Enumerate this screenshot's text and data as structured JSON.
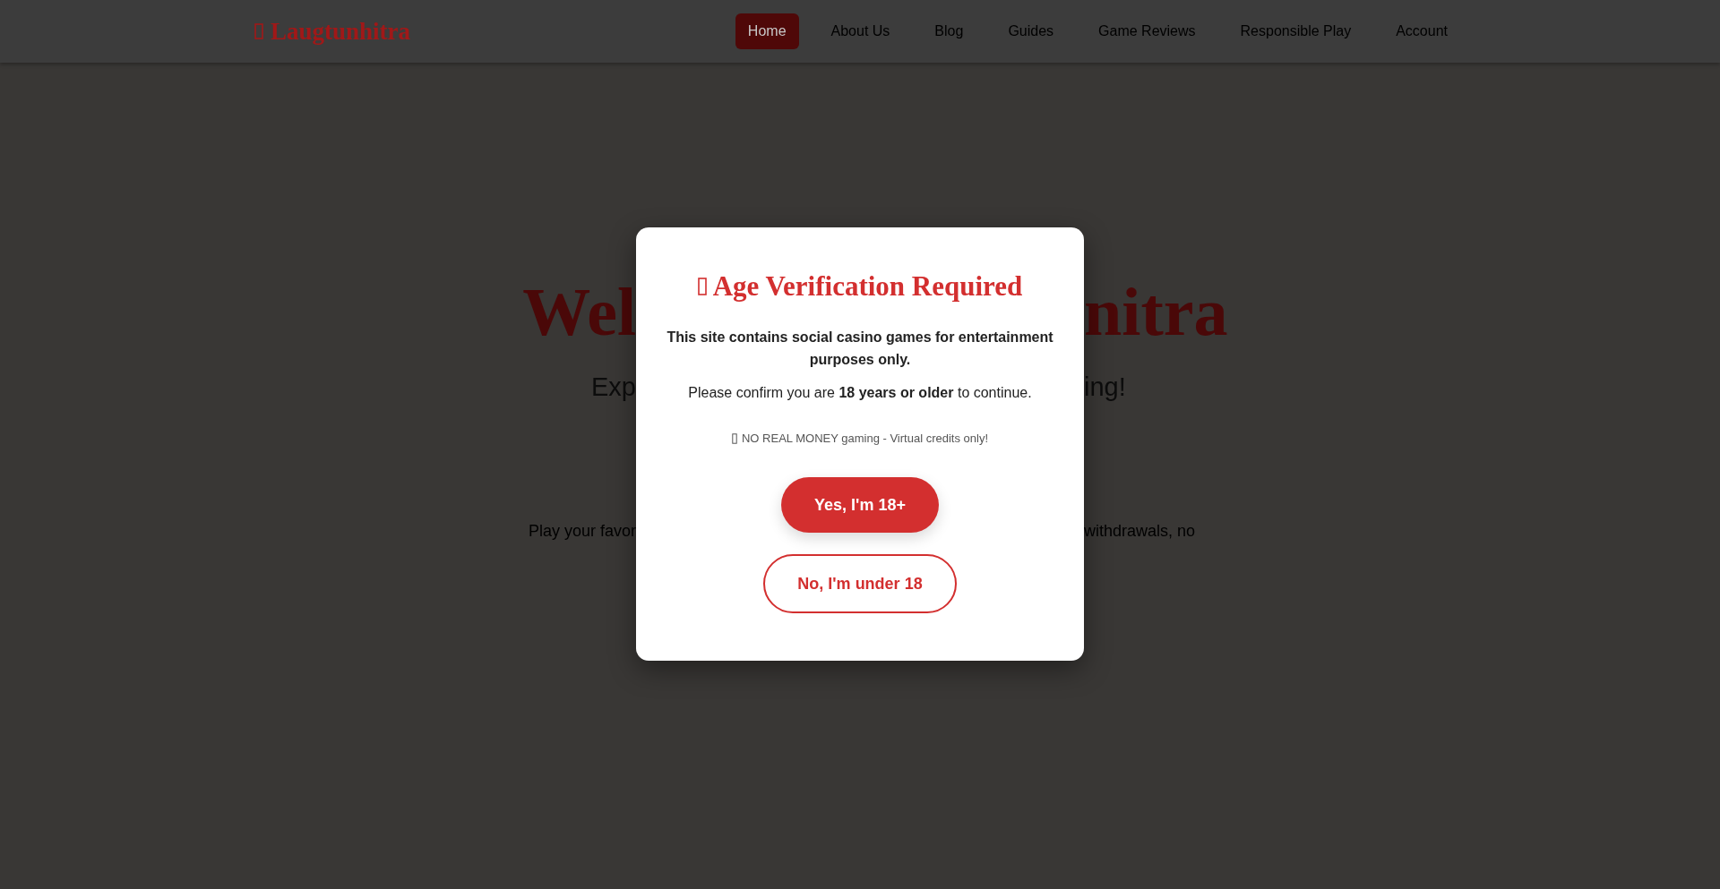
{
  "header": {
    "logo": "Laugtunhitra",
    "nav": [
      {
        "label": "Home",
        "selected": true
      },
      {
        "label": "About Us",
        "selected": false
      },
      {
        "label": "Blog",
        "selected": false
      },
      {
        "label": "Guides",
        "selected": false
      },
      {
        "label": "Game Reviews",
        "selected": false
      },
      {
        "label": "Responsible Play",
        "selected": false
      },
      {
        "label": "Account",
        "selected": false
      }
    ]
  },
  "hero": {
    "heading": [
      "Wel",
      "nitra"
    ],
    "subtitle": [
      "Exp",
      "ing!"
    ],
    "text": [
      "Play your favor",
      "withdrawals, no"
    ]
  },
  "modal": {
    "title": "Age Verification Required",
    "message": "This site contains social casino games for entertainment purposes only.",
    "prompt": "Please confirm you are **18 years or older** to continue.",
    "note": "NO REAL MONEY gaming - Virtual credits only!",
    "buttons": [
      {
        "label": "Yes, I'm 18+",
        "kind": "primary"
      },
      {
        "label": "No, I'm under 18",
        "kind": "outline"
      }
    ]
  }
}
